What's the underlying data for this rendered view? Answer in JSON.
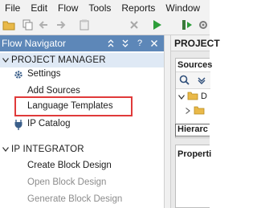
{
  "menubar": {
    "items": [
      {
        "label": "File"
      },
      {
        "label": "Edit"
      },
      {
        "label": "Flow"
      },
      {
        "label": "Tools"
      },
      {
        "label": "Reports"
      },
      {
        "label": "Window"
      }
    ]
  },
  "toolbar": {
    "icons": [
      "open-folder-icon",
      "undo-icon",
      "redo-icon",
      "copy-icon",
      "delete-icon",
      "run-icon",
      "step-icon",
      "settings-icon"
    ]
  },
  "flow_navigator": {
    "title": "Flow Navigator",
    "header_icons": [
      "collapse-all-icon",
      "expand-all-icon",
      "help-icon",
      "close-icon"
    ],
    "sections": [
      {
        "label": "PROJECT MANAGER",
        "items": [
          {
            "label": "Settings",
            "icon": "gear-icon",
            "disabled": false
          },
          {
            "label": "Add Sources",
            "icon": "",
            "disabled": false
          },
          {
            "label": "Language Templates",
            "icon": "",
            "disabled": false
          },
          {
            "label": "IP Catalog",
            "icon": "plug-icon",
            "disabled": false
          }
        ]
      },
      {
        "label": "IP INTEGRATOR",
        "items": [
          {
            "label": "Create Block Design",
            "disabled": false
          },
          {
            "label": "Open Block Design",
            "disabled": true
          },
          {
            "label": "Generate Block Design",
            "disabled": true
          }
        ]
      }
    ]
  },
  "right_panel": {
    "title": "PROJECT",
    "sources_title": "Sources",
    "tree_letter": "D",
    "hierarchy_tab": "Hierarc",
    "properties_title": "Properti"
  },
  "colors": {
    "header_bg": "#5d87b8",
    "selected_section_bg": "#dfe9f5",
    "highlight_border": "#e03a3a",
    "run_green": "#2e9e3a"
  }
}
